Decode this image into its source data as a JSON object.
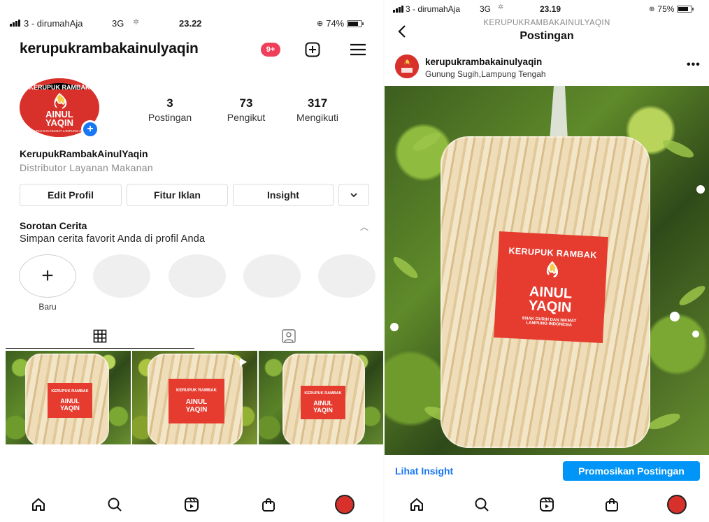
{
  "left_screen": {
    "status": {
      "carrier": "3 - dirumahAja",
      "network": "3G",
      "time": "23.22",
      "battery": "74%",
      "battery_level": 0.74
    },
    "header": {
      "username": "kerupukrambakainulyaqin",
      "notification_badge": "9+"
    },
    "stats": [
      {
        "value": "3",
        "label": "Postingan"
      },
      {
        "value": "73",
        "label": "Pengikut"
      },
      {
        "value": "317",
        "label": "Mengikuti"
      }
    ],
    "profile": {
      "display_name": "KerupukRambakAinulYaqin",
      "category": "Distributor Layanan Makanan"
    },
    "buttons": {
      "edit": "Edit Profil",
      "ads": "Fitur Iklan",
      "insight": "Insight"
    },
    "highlights": {
      "title": "Sorotan Cerita",
      "subtitle": "Simpan cerita favorit Anda di profil Anda",
      "new_label": "Baru"
    },
    "logo_text": {
      "top": "KERUPUK RAMBAK",
      "name_line1": "AINUL",
      "name_line2": "YAQIN",
      "tagline": "ENAK GURIH DAN NIKMAT LAMPUNG-INDONESIA"
    },
    "grid_label": {
      "top": "KERUPUK RAMBAK",
      "name_line1": "AINUL",
      "name_line2": "YAQIN"
    }
  },
  "right_screen": {
    "status": {
      "carrier": "3 - dirumahAja",
      "network": "3G",
      "time": "23.19",
      "battery": "75%",
      "battery_level": 0.75
    },
    "header": {
      "account": "KERUPUKRAMBAKAINULYAQIN",
      "title": "Postingan"
    },
    "post": {
      "username": "kerupukrambakainulyaqin",
      "location": "Gunung Sugih,Lampung Tengah",
      "label_top": "KERUPUK RAMBAK",
      "label_name1": "AINUL",
      "label_name2": "YAQIN",
      "label_tag1": "ENAK GURIH DAN NIKMAT",
      "label_tag2": "LAMPUNG-INDONESIA"
    },
    "actions": {
      "insight_link": "Lihat Insight",
      "promote": "Promosikan Postingan"
    }
  },
  "nav_icons": [
    "home-icon",
    "search-icon",
    "reels-icon",
    "shop-icon",
    "profile-avatar"
  ],
  "colors": {
    "accent_blue": "#0095f6",
    "link_blue": "#1877f2",
    "badge_red": "#ef3f5a",
    "brand_red": "#e63c30"
  }
}
